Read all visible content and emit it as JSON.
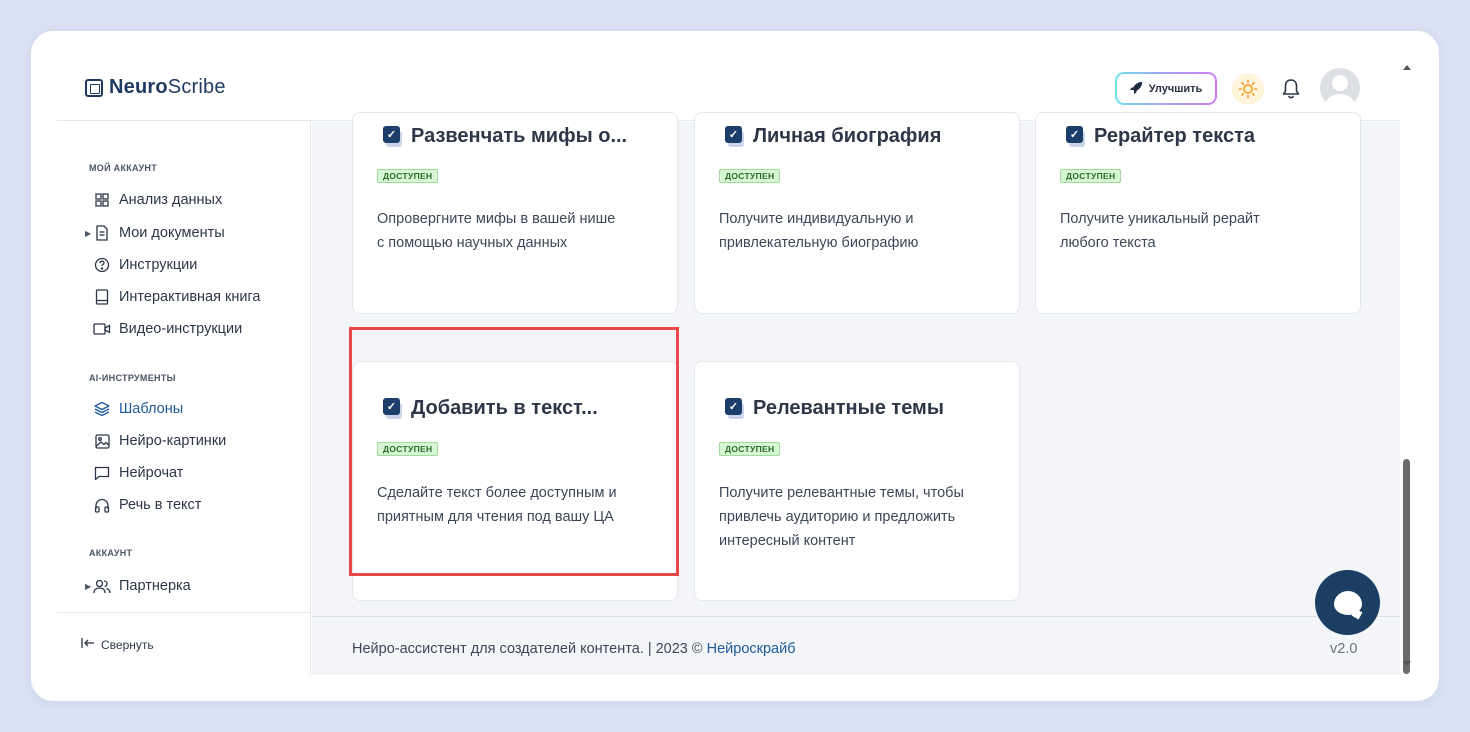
{
  "app": {
    "logo_bold": "Neuro",
    "logo_light": "Scribe"
  },
  "header": {
    "upgrade_label": "Улучшить",
    "theme_icon": "sun-icon",
    "bell_icon": "bell-icon"
  },
  "sidebar": {
    "sections": {
      "account": "МОЙ АККАУНТ",
      "ai_tools": "AI-ИНСТРУМЕНТЫ",
      "account2": "АККАУНТ"
    },
    "items": [
      {
        "label": "Анализ данных",
        "icon": "grid-icon"
      },
      {
        "label": "Мои документы",
        "icon": "document-icon"
      },
      {
        "label": "Инструкции",
        "icon": "help-icon"
      },
      {
        "label": "Интерактивная книга",
        "icon": "book-icon"
      },
      {
        "label": "Видео-инструкции",
        "icon": "video-icon"
      },
      {
        "label": "Шаблоны",
        "icon": "layers-icon",
        "active": true
      },
      {
        "label": "Нейро-картинки",
        "icon": "image-icon"
      },
      {
        "label": "Нейрочат",
        "icon": "chat-icon"
      },
      {
        "label": "Речь в текст",
        "icon": "headphones-icon"
      },
      {
        "label": "Партнерка",
        "icon": "users-icon"
      }
    ],
    "collapse_label": "Свернуть"
  },
  "cards": [
    {
      "title": "Развенчать мифы о...",
      "badge": "ДОСТУПЕН",
      "desc_line1": "Опровергните мифы в вашей нише",
      "desc_line2": "с помощью научных данных",
      "desc_line3": ""
    },
    {
      "title": "Личная биография",
      "badge": "ДОСТУПЕН",
      "desc_line1": "Получите индивидуальную и",
      "desc_line2": "привлекательную биографию",
      "desc_line3": ""
    },
    {
      "title": "Рерайтер текста",
      "badge": "ДОСТУПЕН",
      "desc_line1": "Получите уникальный рерайт",
      "desc_line2": "любого текста",
      "desc_line3": ""
    },
    {
      "title": "Добавить в текст...",
      "badge": "ДОСТУПЕН",
      "desc_line1": "Сделайте текст более доступным и",
      "desc_line2": "приятным для чтения под вашу ЦА",
      "desc_line3": ""
    },
    {
      "title": "Релевантные темы",
      "badge": "ДОСТУПЕН",
      "desc_line1": "Получите релевантные темы, чтобы",
      "desc_line2": "привлечь аудиторию и предложить",
      "desc_line3": "интересный контент"
    }
  ],
  "footer": {
    "text": "Нейро-ассистент для создателей контента.  | 2023 © ",
    "brand": "Нейроскрайб",
    "version": "v2.0"
  }
}
